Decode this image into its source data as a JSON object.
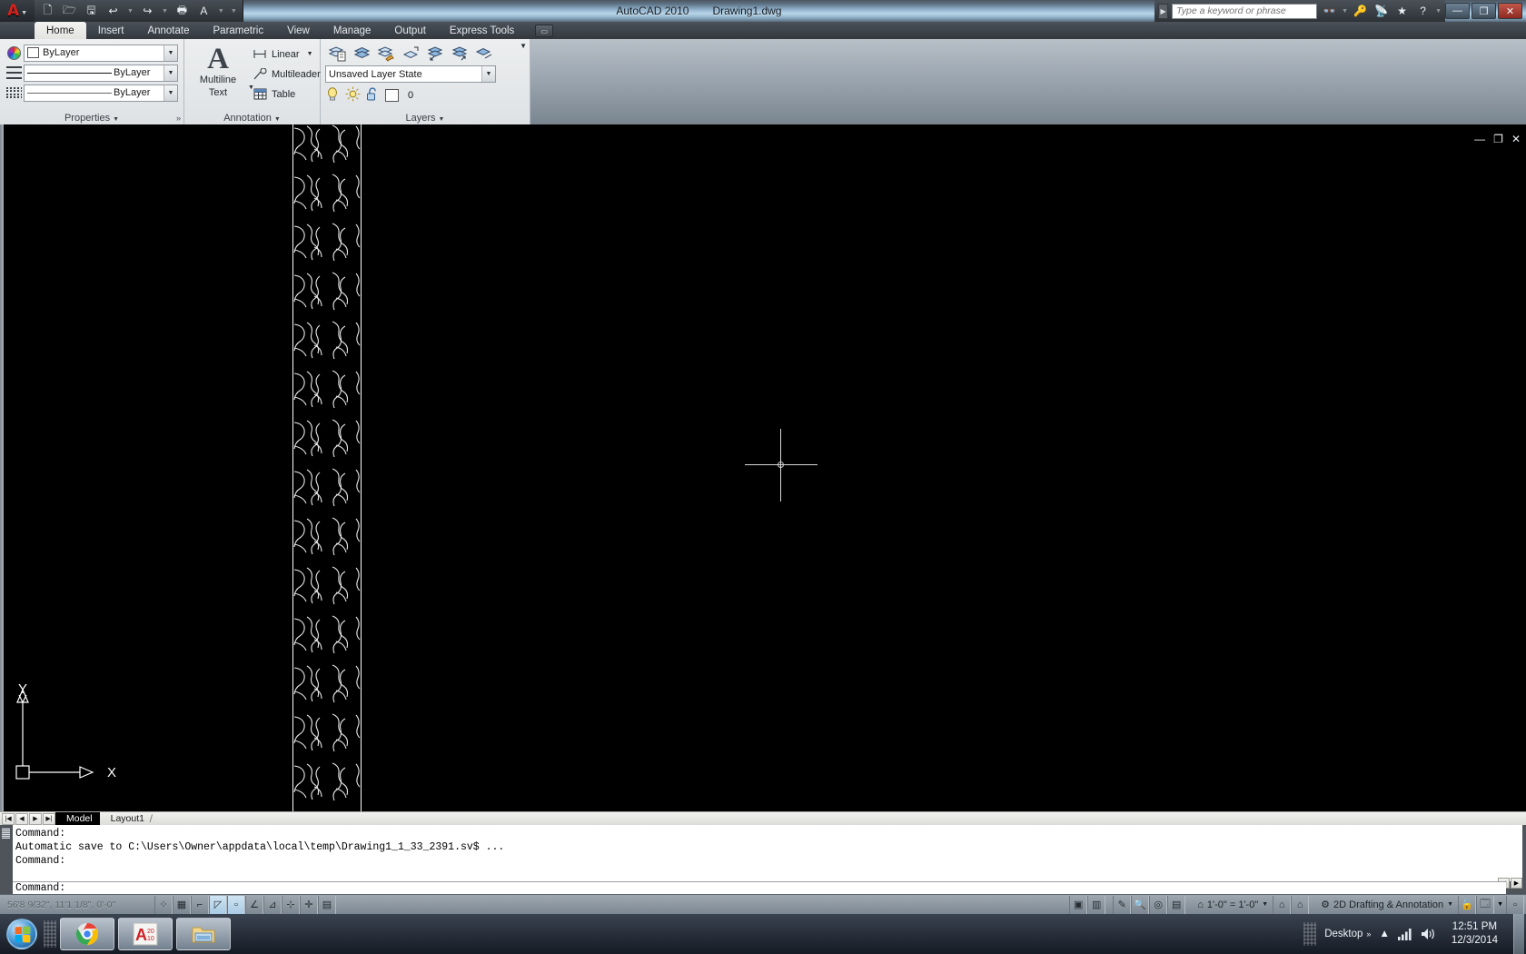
{
  "titlebar": {
    "app_name": "AutoCAD 2010",
    "document_name": "Drawing1.dwg",
    "logo": "autocad-logo",
    "quick_access": [
      {
        "name": "new-icon",
        "glyph": "🗋"
      },
      {
        "name": "open-icon",
        "glyph": "🗁"
      },
      {
        "name": "save-icon",
        "glyph": "🖫"
      },
      {
        "name": "undo-icon",
        "glyph": "↩"
      },
      {
        "name": "redo-icon",
        "glyph": "↪"
      },
      {
        "name": "plot-icon",
        "glyph": "🖶"
      },
      {
        "name": "text-style-icon",
        "glyph": "A"
      }
    ],
    "search_placeholder": "Type a keyword or phrase",
    "search_value": "",
    "help_icons": [
      {
        "name": "infocenter-icon",
        "glyph": "👓"
      },
      {
        "name": "subscription-key-icon",
        "glyph": "🔑"
      },
      {
        "name": "communication-center-icon",
        "glyph": "📡"
      },
      {
        "name": "favorites-star-icon",
        "glyph": "★"
      },
      {
        "name": "help-icon",
        "glyph": "?"
      }
    ],
    "window_buttons": [
      {
        "name": "minimize-button",
        "glyph": "—"
      },
      {
        "name": "restore-button",
        "glyph": "❐"
      },
      {
        "name": "close-button",
        "glyph": "✕"
      }
    ]
  },
  "ribbon": {
    "tabs": [
      {
        "label": "Home",
        "active": true
      },
      {
        "label": "Insert",
        "active": false
      },
      {
        "label": "Annotate",
        "active": false
      },
      {
        "label": "Parametric",
        "active": false
      },
      {
        "label": "View",
        "active": false
      },
      {
        "label": "Manage",
        "active": false
      },
      {
        "label": "Output",
        "active": false
      },
      {
        "label": "Express Tools",
        "active": false
      }
    ],
    "panels": {
      "properties": {
        "title": "Properties",
        "color_value": "ByLayer",
        "linetype_value": "ByLayer",
        "lineweight_value": "ByLayer"
      },
      "annotation": {
        "title": "Annotation",
        "multiline_line1": "Multiline",
        "multiline_line2": "Text",
        "items": [
          {
            "label": "Linear",
            "icon": "linear-dimension-icon",
            "has_caret": true
          },
          {
            "label": "Multileader",
            "icon": "multileader-icon",
            "has_caret": true
          },
          {
            "label": "Table",
            "icon": "table-icon",
            "has_caret": false
          }
        ]
      },
      "layers": {
        "title": "Layers",
        "layer_state_value": "Unsaved Layer State",
        "current_layer": "0",
        "tool_icons": [
          "layer-properties-icon",
          "layer-new-icon",
          "layer-match-icon",
          "layer-isolate-icon",
          "layer-previous-icon",
          "layer-make-current-icon",
          "layer-off-icon"
        ],
        "toggles": [
          "layer-on-bulb-icon",
          "layer-freeze-sun-icon",
          "layer-unlock-icon",
          "layer-color-swatch"
        ]
      }
    }
  },
  "drawing": {
    "window_controls": [
      {
        "name": "drawing-minimize-icon",
        "glyph": "—"
      },
      {
        "name": "drawing-restore-icon",
        "glyph": "❐"
      },
      {
        "name": "drawing-close-icon",
        "glyph": "✕"
      }
    ],
    "ucs_labels": {
      "x": "X",
      "y": "Y"
    },
    "content_description": "stone-veneer-hatch-band"
  },
  "model_tabs": {
    "nav_buttons": [
      "first-layout-icon",
      "previous-layout-icon",
      "next-layout-icon",
      "last-layout-icon"
    ],
    "tabs": [
      {
        "label": "Model",
        "active": true
      },
      {
        "label": "Layout1",
        "active": false
      }
    ]
  },
  "command_line": {
    "history": [
      "Command:",
      "Automatic save to C:\\Users\\Owner\\appdata\\local\\temp\\Drawing1_1_33_2391.sv$ ...",
      "Command:"
    ],
    "prompt": "Command:",
    "input_value": ""
  },
  "status_bar": {
    "coordinates": "56'8 9/32\", 11'1 1/8\", 0'-0\"",
    "left_toggles": [
      {
        "name": "infer-constraints-button",
        "glyph": "⁘",
        "active": false
      },
      {
        "name": "snap-mode-button",
        "glyph": "▦",
        "active": false
      },
      {
        "name": "grid-display-button",
        "glyph": "⌐",
        "active": false
      },
      {
        "name": "ortho-mode-button",
        "glyph": "◿",
        "active": true
      },
      {
        "name": "polar-tracking-button",
        "glyph": "◻",
        "active": true
      },
      {
        "name": "object-snap-button",
        "glyph": "∠",
        "active": false
      },
      {
        "name": "object-snap-tracking-button",
        "glyph": "⊿",
        "active": false
      },
      {
        "name": "allow-ucs-button",
        "glyph": "⊹",
        "active": false
      },
      {
        "name": "dynamic-input-button",
        "glyph": "✛",
        "active": false
      },
      {
        "name": "lineweight-button",
        "glyph": "▤",
        "active": false
      }
    ],
    "right_items": [
      {
        "name": "model-space-button",
        "glyph": "▣"
      },
      {
        "name": "layout-space-button",
        "glyph": "▥"
      },
      {
        "name": "quick-properties-button",
        "glyph": "✎"
      },
      {
        "name": "zoom-button",
        "glyph": "🔍"
      },
      {
        "name": "pan-button",
        "glyph": "✋"
      },
      {
        "name": "steering-wheel-button",
        "glyph": "◎"
      },
      {
        "name": "showmotion-button",
        "glyph": "🎬"
      }
    ],
    "annotation_scale": "1'-0\" = 1'-0\"",
    "workspace": "2D Drafting & Annotation",
    "lock_icon": "toolbar-lock-icon",
    "clean_screen_icon": "clean-screen-icon"
  },
  "taskbar": {
    "start_label": "start-orb",
    "apps": [
      {
        "name": "taskbar-chrome-icon",
        "label": "Google Chrome"
      },
      {
        "name": "taskbar-autocad-icon",
        "label": "AutoCAD 2010"
      },
      {
        "name": "taskbar-explorer-icon",
        "label": "Windows Explorer"
      }
    ],
    "desktop_label": "Desktop",
    "overflow_glyph": "»",
    "tray_icons": [
      {
        "name": "show-hidden-icons-icon",
        "glyph": "▲"
      },
      {
        "name": "network-icon",
        "glyph": "📶"
      },
      {
        "name": "volume-icon",
        "glyph": "🔊"
      }
    ],
    "time": "12:51 PM",
    "date": "12/3/2014"
  },
  "colors": {
    "accent_red": "#d0231f",
    "canvas_bg": "#000000",
    "ribbon_bg": "#d6dade",
    "status_bg": "#8c96a0",
    "active_toggle": "#a8cbe4"
  }
}
